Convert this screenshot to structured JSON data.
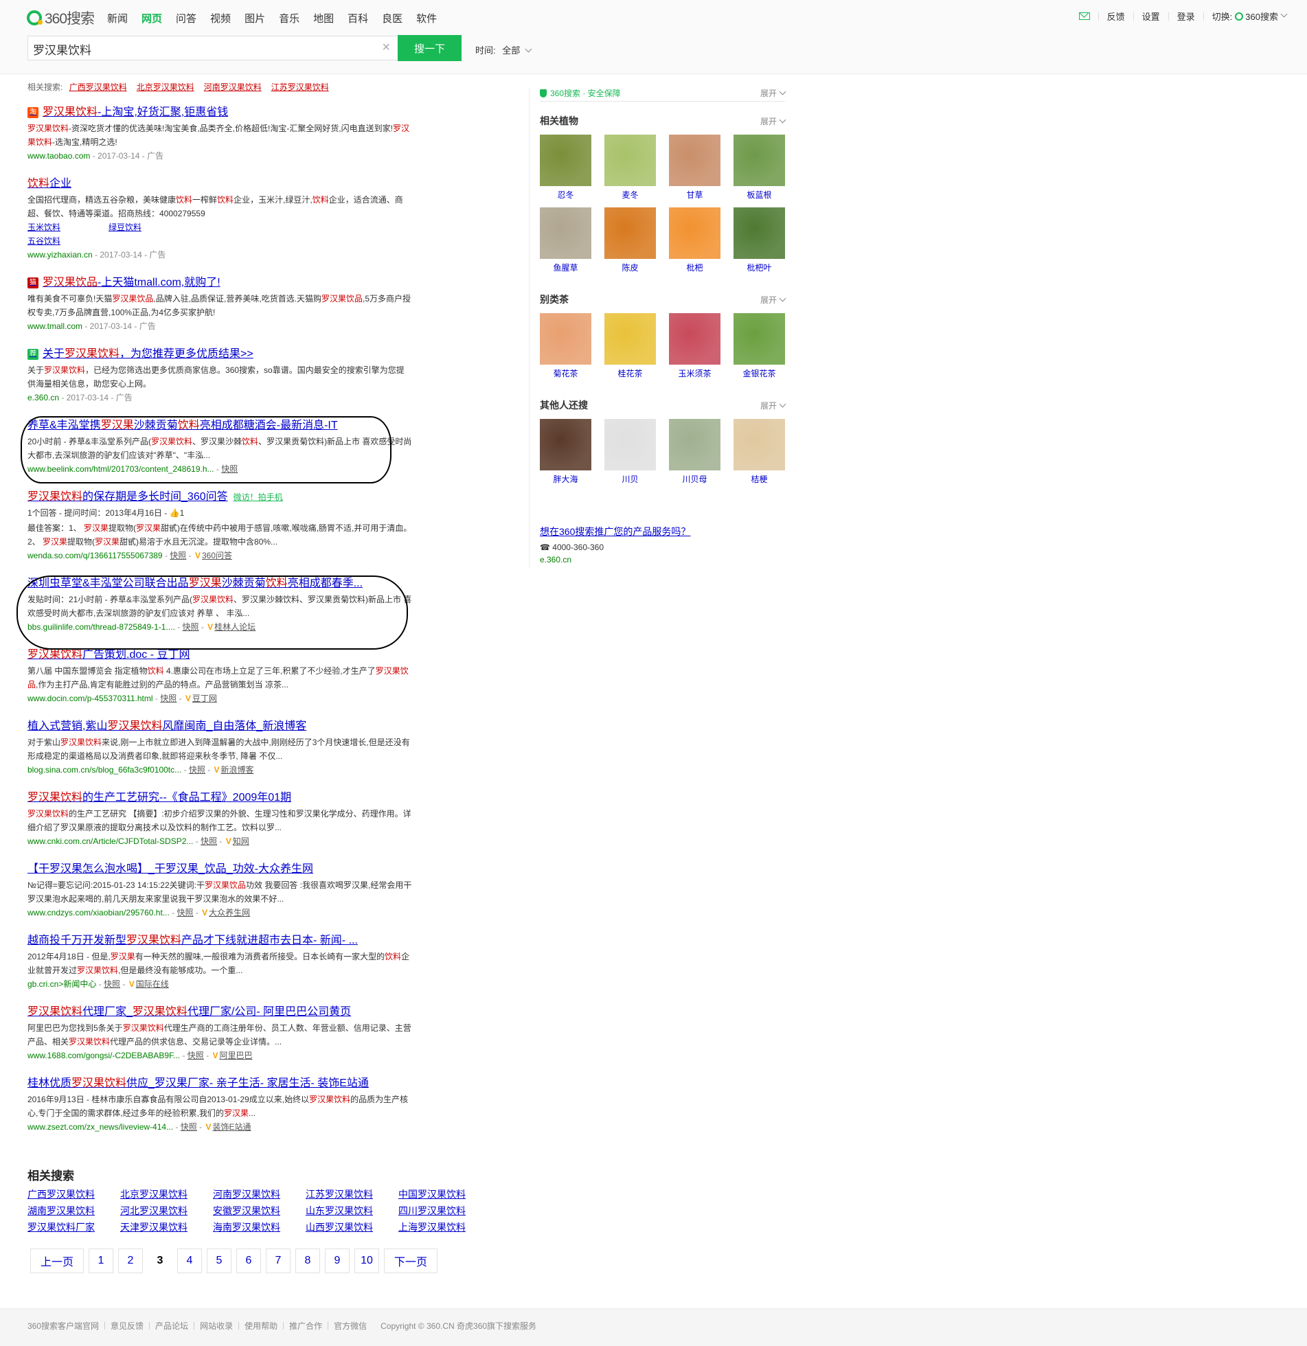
{
  "header": {
    "logo_text": "360搜索",
    "nav": [
      "新闻",
      "网页",
      "问答",
      "视频",
      "图片",
      "音乐",
      "地图",
      "百科",
      "良医",
      "软件"
    ],
    "top_links": [
      "反馈",
      "设置",
      "登录"
    ],
    "switch_label": "切换:",
    "switch_target": "360搜索"
  },
  "search": {
    "query": "罗汉果饮料",
    "button": "搜一下",
    "time_label": "时间:",
    "time_value": "全部"
  },
  "related_top": {
    "label": "相关搜索:",
    "items": [
      "广西罗汉果饮料",
      "北京罗汉果饮料",
      "河南罗汉果饮料",
      "江苏罗汉果饮料"
    ]
  },
  "results": [
    {
      "title_parts": [
        {
          "t": "罗汉果饮料",
          "em": true
        },
        {
          "t": "-上淘宝,好货汇聚,钜惠省钱",
          "em": false
        }
      ],
      "desc_parts": [
        {
          "t": "罗汉果饮料",
          "em": true
        },
        {
          "t": "-资深吃货才懂的优选美味!淘宝美食,品类齐全,价格超低!淘宝-汇聚全网好货,闪电直送到家!",
          "em": false
        },
        {
          "t": "罗汉果饮料",
          "em": true
        },
        {
          "t": "-选淘宝,精明之选!",
          "em": false
        }
      ],
      "url": "www.taobao.com",
      "meta": " - 2017-03-14 - 广告",
      "badge": "淘",
      "badge_color": "#ff5000"
    },
    {
      "title_parts": [
        {
          "t": "饮料",
          "em": true
        },
        {
          "t": "企业",
          "em": false
        }
      ],
      "desc_parts": [
        {
          "t": "全国招代理商，精选五谷杂粮，美味健康",
          "em": false
        },
        {
          "t": "饮料",
          "em": true
        },
        {
          "t": "一榨鲜",
          "em": false
        },
        {
          "t": "饮料",
          "em": true
        },
        {
          "t": "企业，玉米汁,绿豆汁,",
          "em": false
        },
        {
          "t": "饮料",
          "em": true
        },
        {
          "t": "企业，适合流通、商超、餐饮、特通等渠道。招商热线：4000279559",
          "em": false
        }
      ],
      "sublinks": [
        "玉米饮料",
        "绿豆饮料",
        "五谷饮料"
      ],
      "url": "www.yizhaxian.cn",
      "meta": " - 2017-03-14 - 广告"
    },
    {
      "title_parts": [
        {
          "t": "罗汉果饮品",
          "em": true
        },
        {
          "t": "-上天猫tmall.com,就购了!",
          "em": false
        }
      ],
      "desc_parts": [
        {
          "t": "唯有美食不可辜负!天猫",
          "em": false
        },
        {
          "t": "罗汉果饮品",
          "em": true
        },
        {
          "t": ",品牌入驻,品质保证,营养美味,吃货首选.天猫购",
          "em": false
        },
        {
          "t": "罗汉果饮品",
          "em": true
        },
        {
          "t": ",5万多商户授权专卖,7万多品牌直营,100%正品,为4亿多买家护航!",
          "em": false
        }
      ],
      "url": "www.tmall.com",
      "meta": " - 2017-03-14 - 广告",
      "badge": "猫",
      "badge_color": "#c40000"
    },
    {
      "title_parts": [
        {
          "t": "关于",
          "em": false
        },
        {
          "t": "罗汉果饮料",
          "em": true
        },
        {
          "t": "，为您推荐更多优质结果>>",
          "em": false
        }
      ],
      "desc_parts": [
        {
          "t": "关于",
          "em": false
        },
        {
          "t": "罗汉果饮料",
          "em": true
        },
        {
          "t": "，已经为您筛选出更多优质商家信息。360搜索，so靠谱。国内最安全的搜索引擎为您提供海量相关信息，助您安心上网。",
          "em": false
        }
      ],
      "url": "e.360.cn",
      "meta": " - 2017-03-14 - 广告",
      "badge": "荐",
      "badge_color": "#19b955"
    },
    {
      "title_parts": [
        {
          "t": "养草&丰泓堂携",
          "em": false
        },
        {
          "t": "罗汉果",
          "em": true
        },
        {
          "t": "沙棘贡菊",
          "em": false
        },
        {
          "t": "饮料",
          "em": true
        },
        {
          "t": "亮相成都糖酒会-最新消息-IT",
          "em": false
        }
      ],
      "desc_parts": [
        {
          "t": "20小时前 - 养草&丰泓堂系列产品(",
          "em": false
        },
        {
          "t": "罗汉果饮料",
          "em": true
        },
        {
          "t": "、罗汉果沙棘",
          "em": false
        },
        {
          "t": "饮料",
          "em": true
        },
        {
          "t": "、罗汉果贡菊饮料)新品上市 喜欢感受时尚大都市,去深圳旅游的驴友们应该对\"养草\"、\"丰泓...",
          "em": false
        }
      ],
      "url": "www.beelink.com/html/201703/content_248619.h...",
      "meta": " - ",
      "links": [
        "快照"
      ]
    },
    {
      "title_parts": [
        {
          "t": "罗汉果饮料",
          "em": true
        },
        {
          "t": "的保存期是多长时间_360问答",
          "em": false
        }
      ],
      "tag": "微访！拍手机",
      "desc_parts": [
        {
          "t": "1个回答 - 提问时间：2013年4月16日 - 👍1",
          "em": false
        }
      ],
      "desc2_parts": [
        {
          "t": "最佳答案：1、 ",
          "em": false
        },
        {
          "t": "罗汉果",
          "em": true
        },
        {
          "t": "提取物(",
          "em": false
        },
        {
          "t": "罗汉果",
          "em": true
        },
        {
          "t": "甜甙)在传统中药中被用于感冒,咳嗽,喉咙痛,肠胃不适,并可用于清血。 2、 ",
          "em": false
        },
        {
          "t": "罗汉果",
          "em": true
        },
        {
          "t": "提取物(",
          "em": false
        },
        {
          "t": "罗汉果",
          "em": true
        },
        {
          "t": "甜甙)易溶于水且无沉淀。提取物中含80%...",
          "em": false
        }
      ],
      "url": "wenda.so.com/q/1366117555067389",
      "meta": " - ",
      "links": [
        "快照",
        "360问答"
      ]
    },
    {
      "title_parts": [
        {
          "t": "深圳虫草堂&丰泓堂公司联合出品",
          "em": false
        },
        {
          "t": "罗汉果",
          "em": true
        },
        {
          "t": "沙棘贡菊",
          "em": false
        },
        {
          "t": "饮料",
          "em": true
        },
        {
          "t": "亮相成都春季...",
          "em": false
        }
      ],
      "desc_parts": [
        {
          "t": "发贴时间：21小时前 - 养草&丰泓堂系列产品(",
          "em": false
        },
        {
          "t": "罗汉果饮料",
          "em": true
        },
        {
          "t": "、罗汉果沙棘饮料、罗汉果贡菊饮料)新品上市 喜欢感受时尚大都市,去深圳旅游的驴友们应该对 养草 、 丰泓...",
          "em": false
        }
      ],
      "url": "bbs.guilinlife.com/thread-8725849-1-1....",
      "meta": " - ",
      "links": [
        "快照",
        "桂林人论坛"
      ]
    },
    {
      "title_parts": [
        {
          "t": "罗汉果饮料",
          "em": true
        },
        {
          "t": "广告策划.doc - 豆丁网",
          "em": false
        }
      ],
      "desc_parts": [
        {
          "t": "第八届 中国东盟博览会 指定植物",
          "em": false
        },
        {
          "t": "饮料",
          "em": true
        },
        {
          "t": " 4.惠康公司在市场上立足了三年,积累了不少经验,才生产了",
          "em": false
        },
        {
          "t": "罗汉果饮品",
          "em": true
        },
        {
          "t": ",作为主打产品,肯定有能胜过别的产品的特点。产品营销策划当 凉茶...",
          "em": false
        }
      ],
      "url": "www.docin.com/p-455370311.html",
      "meta": " - ",
      "links": [
        "快照",
        "豆丁网"
      ]
    },
    {
      "title_parts": [
        {
          "t": "植入式营销,紫山",
          "em": false
        },
        {
          "t": "罗汉果饮料",
          "em": true
        },
        {
          "t": "风靡闽南_自由落体_新浪博客",
          "em": false
        }
      ],
      "desc_parts": [
        {
          "t": "对于紫山",
          "em": false
        },
        {
          "t": "罗汉果饮料",
          "em": true
        },
        {
          "t": "来说,刚一上市就立即进入到降温解暑的大战中,刚刚经历了3个月快速增长,但是还没有形成稳定的渠道格局以及消费者印象,就即将迎来秋冬季节, 降暑 不仅...",
          "em": false
        }
      ],
      "url": "blog.sina.com.cn/s/blog_66fa3c9f0100tc...",
      "meta": " - ",
      "links": [
        "快照",
        "新浪博客"
      ]
    },
    {
      "title_parts": [
        {
          "t": "罗汉果饮料",
          "em": true
        },
        {
          "t": "的生产工艺研究--《食品工程》2009年01期",
          "em": false
        }
      ],
      "desc_parts": [
        {
          "t": "罗汉果饮料",
          "em": true
        },
        {
          "t": "的生产工艺研究 【摘要】:初步介绍罗汉果的外貌、生理习性和罗汉果化学成分、药理作用。详细介绍了罗汉果原液的提取分离技术以及饮料的制作工艺。饮料以罗...",
          "em": false
        }
      ],
      "url": "www.cnki.com.cn/Article/CJFDTotal-SDSP2...",
      "meta": " - ",
      "links": [
        "快照",
        "知网"
      ]
    },
    {
      "title_parts": [
        {
          "t": "【干罗汉果怎么泡水喝】_干罗汉果_饮品_功效-大众养生网",
          "em": false
        }
      ],
      "desc_parts": [
        {
          "t": "№记得=要忘记问:2015-01-23 14:15:22关键词:干",
          "em": false
        },
        {
          "t": "罗汉果饮品",
          "em": true
        },
        {
          "t": "功效 我要回答 :我很喜欢喝罗汉果,经常会用干罗汉果泡水起来喝的,前几天朋友来家里说我干罗汉果泡水的效果不好...",
          "em": false
        }
      ],
      "url": "www.cndzys.com/xiaobian/295760.ht...",
      "meta": " - ",
      "links": [
        "快照",
        "大众养生网"
      ]
    },
    {
      "title_parts": [
        {
          "t": "越商投千万开发新型",
          "em": false
        },
        {
          "t": "罗汉果饮料",
          "em": true
        },
        {
          "t": "产品才下线就进超市去日本- 新闻- ...",
          "em": false
        }
      ],
      "desc_parts": [
        {
          "t": "2012年4月18日 - 但是,",
          "em": false
        },
        {
          "t": "罗汉果",
          "em": true
        },
        {
          "t": "有一种天然的腥味,一般很难为消费者所接受。日本长崎有一家大型的",
          "em": false
        },
        {
          "t": "饮料",
          "em": true
        },
        {
          "t": "企业就曾开发过",
          "em": false
        },
        {
          "t": "罗汉果饮料",
          "em": true
        },
        {
          "t": ",但是最终没有能够成功。一个重...",
          "em": false
        }
      ],
      "url": "gb.cri.cn>新闻中心",
      "meta": " - ",
      "links": [
        "快照",
        "国际在线"
      ]
    },
    {
      "title_parts": [
        {
          "t": "罗汉果饮料",
          "em": true
        },
        {
          "t": "代理厂家_",
          "em": false
        },
        {
          "t": "罗汉果饮料",
          "em": true
        },
        {
          "t": "代理厂家/公司- 阿里巴巴公司黄页",
          "em": false
        }
      ],
      "desc_parts": [
        {
          "t": "阿里巴巴为您找到5条关于",
          "em": false
        },
        {
          "t": "罗汉果饮料",
          "em": true
        },
        {
          "t": "代理生产商的工商注册年份、员工人数、年营业额、信用记录、主营产品、相关",
          "em": false
        },
        {
          "t": "罗汉果饮料",
          "em": true
        },
        {
          "t": "代理产品的供求信息、交易记录等企业详情。...",
          "em": false
        }
      ],
      "url": "www.1688.com/gongsi/-C2DEBABAB9F...",
      "meta": " - ",
      "links": [
        "快照",
        "阿里巴巴"
      ]
    },
    {
      "title_parts": [
        {
          "t": "桂林优质",
          "em": false
        },
        {
          "t": "罗汉果饮料",
          "em": true
        },
        {
          "t": "供应_罗汉果厂家- 亲子生活- 家居生活- 装饰E站通",
          "em": false
        }
      ],
      "desc_parts": [
        {
          "t": "2016年9月13日 - 桂林市康乐自寡食品有限公司自2013-01-29成立以来,始终以",
          "em": false
        },
        {
          "t": "罗汉果饮料",
          "em": true
        },
        {
          "t": "的品质为生产核心,专门于全国的需求群体,经过多年的经验积累,我们的",
          "em": false
        },
        {
          "t": "罗汉果",
          "em": true
        },
        {
          "t": "...",
          "em": false
        }
      ],
      "url": "www.zsezt.com/zx_news/liveview-414...",
      "meta": " - ",
      "links": [
        "快照",
        "装饰E站通"
      ]
    }
  ],
  "sidebar": {
    "safe_text": "360搜索 · 安全保障",
    "expand": "展开",
    "sections": [
      {
        "title": "相关植物",
        "items": [
          "忍冬",
          "麦冬",
          "甘草",
          "板蓝根",
          "鱼腥草",
          "陈皮",
          "枇杷",
          "枇杷叶"
        ]
      },
      {
        "title": "别类茶",
        "items": [
          "菊花茶",
          "桂花茶",
          "玉米须茶",
          "金银花茶"
        ]
      },
      {
        "title": "其他人还搜",
        "items": [
          "胖大海",
          "川贝",
          "川贝母",
          "桔梗"
        ]
      }
    ],
    "promo_text": "想在360搜索推广您的产品服务吗？",
    "promo_phone": "4000-360-360",
    "promo_url": "e.360.cn"
  },
  "related_bottom": {
    "title": "相关搜索",
    "items": [
      "广西罗汉果饮料",
      "北京罗汉果饮料",
      "河南罗汉果饮料",
      "江苏罗汉果饮料",
      "中国罗汉果饮料",
      "湖南罗汉果饮料",
      "河北罗汉果饮料",
      "安徽罗汉果饮料",
      "山东罗汉果饮料",
      "四川罗汉果饮料",
      "罗汉果饮料厂家",
      "天津罗汉果饮料",
      "海南罗汉果饮料",
      "山西罗汉果饮料",
      "上海罗汉果饮料"
    ]
  },
  "pager": {
    "prev": "上一页",
    "pages": [
      "1",
      "2",
      "3",
      "4",
      "5",
      "6",
      "7",
      "8",
      "9",
      "10"
    ],
    "current": "3",
    "next": "下一页"
  },
  "footer": {
    "links": [
      "360搜索客户端官网",
      "意见反馈",
      "产品论坛",
      "网站收录",
      "使用帮助",
      "推广合作",
      "官方微信"
    ],
    "copyright": "Copyright © 360.CN 奇虎360旗下搜索服务"
  },
  "colors": {
    "brand": "#19b955",
    "link": "#0000cc",
    "highlight": "#cc0000",
    "url": "#008000"
  },
  "icons": [
    "mail-icon",
    "logo-icon",
    "clear-icon",
    "shield-icon",
    "chevron-down-icon"
  ]
}
